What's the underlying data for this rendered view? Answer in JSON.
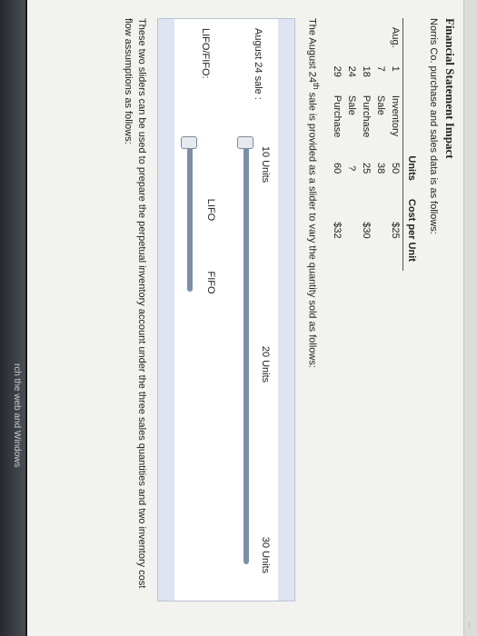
{
  "page": {
    "title": "Financial Statement Impact",
    "intro": "Norris Co. purchase and sales data is as follows:",
    "slider_note_prefix": "The August 24",
    "slider_note_sup": "th",
    "slider_note_suffix": " sale is provided as a slider to vary the quantity sold as follows:",
    "footer_note": "These two sliders can be used to prepare the perpetual inventory account under the three sales quantities and two inventory cost flow assumptions as follows:",
    "taskbar_text": "rch the web and Windows",
    "top_strip_text": "..."
  },
  "table": {
    "headers": [
      "",
      "",
      "",
      "Units",
      "Cost per Unit"
    ],
    "rows": [
      [
        "Aug.",
        "1",
        "Inventory",
        "50",
        "$25"
      ],
      [
        "",
        "7",
        "Sale",
        "38",
        ""
      ],
      [
        "",
        "18",
        "Purchase",
        "25",
        "$30"
      ],
      [
        "",
        "24",
        "Sale",
        "?",
        ""
      ],
      [
        "",
        "29",
        "Purchase",
        "60",
        "$32"
      ]
    ]
  },
  "sliders": {
    "quantity": {
      "label": "August 24 sale :",
      "ticks": [
        "10 Units",
        "20 Units",
        "30 Units"
      ],
      "selected_fraction": 0.0
    },
    "method": {
      "label": "LIFO/FIFO:",
      "ticks": [
        "LIFO",
        "FIFO"
      ],
      "selected_fraction": 0.0
    }
  },
  "colors": {
    "track": "#7d8fa8",
    "panel_band": "#dfe5f0"
  }
}
